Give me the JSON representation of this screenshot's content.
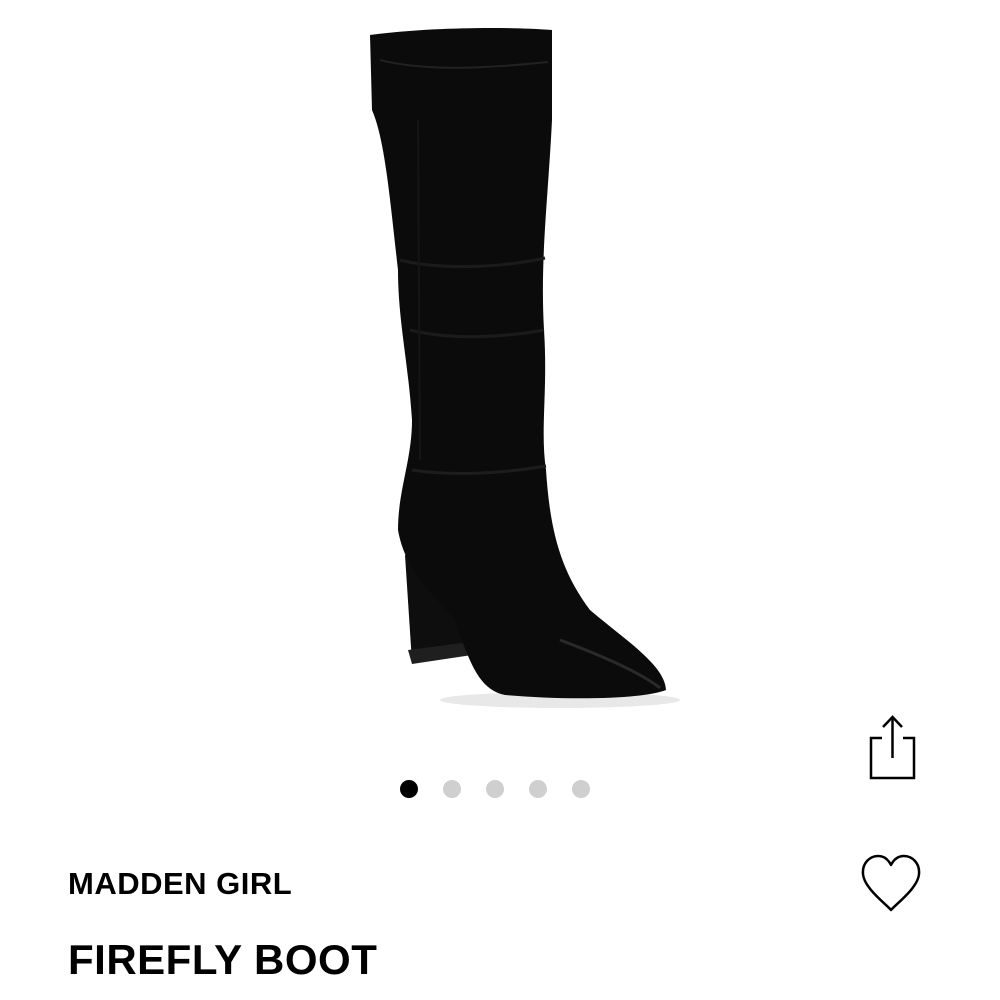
{
  "product": {
    "brand": "MADDEN GIRL",
    "name": "FIREFLY BOOT",
    "image_icon": "knee-high-boot-image",
    "image_color": "#0d0d0d"
  },
  "carousel": {
    "count": 5,
    "active_index": 0,
    "active_color": "#000000",
    "inactive_color": "#cfcfcf"
  },
  "actions": {
    "share_icon": "share-icon",
    "favorite_icon": "heart-icon"
  }
}
